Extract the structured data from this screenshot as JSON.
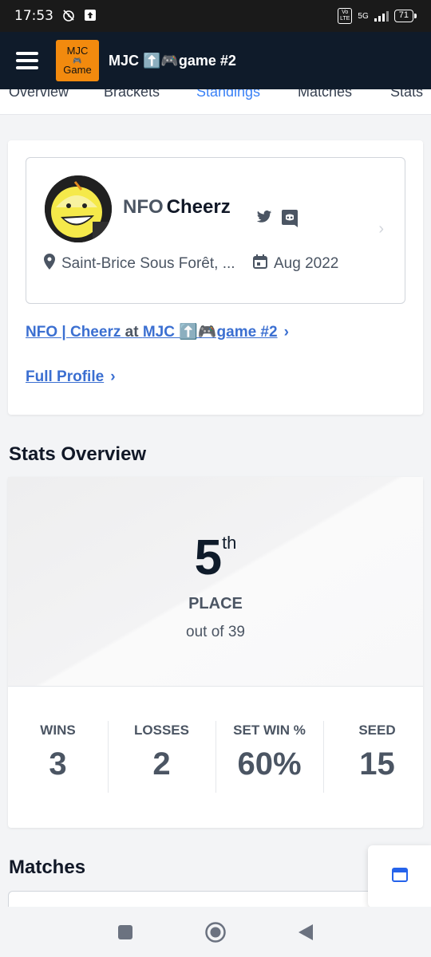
{
  "status_bar": {
    "time": "17:53",
    "network": "5G",
    "battery": "71"
  },
  "app_bar": {
    "logo_line1": "MJC",
    "logo_line2": "Game",
    "title": "MJC ⬆️🎮game #2"
  },
  "tabs": [
    {
      "label": "Overview"
    },
    {
      "label": "Brackets"
    },
    {
      "label": "Standings"
    },
    {
      "label": "Matches"
    },
    {
      "label": "Stats"
    }
  ],
  "profile": {
    "prefix": "NFO",
    "gamertag": "Cheerz",
    "location": "Saint-Brice Sous Forêt, ...",
    "date": "Aug 2022",
    "event_link_prefix": "NFO | Cheerz",
    "event_link_at": "at",
    "event_link_event": "MJC ⬆️🎮game #2",
    "full_profile_label": "Full Profile",
    "social_icons": [
      "twitter-icon",
      "discord-icon"
    ]
  },
  "stats_overview": {
    "heading": "Stats Overview",
    "placement": "5",
    "placement_suffix": "th",
    "place_label": "PLACE",
    "out_of": "out of 39",
    "stats": [
      {
        "label": "WINS",
        "value": "3"
      },
      {
        "label": "LOSSES",
        "value": "2"
      },
      {
        "label": "SET WIN %",
        "value": "60%"
      },
      {
        "label": "SEED",
        "value": "15"
      }
    ]
  },
  "matches": {
    "heading": "Matches"
  },
  "colors": {
    "accent": "#3b6fd1",
    "app_bar": "#0f1b2a",
    "logo": "#f28a0e"
  }
}
